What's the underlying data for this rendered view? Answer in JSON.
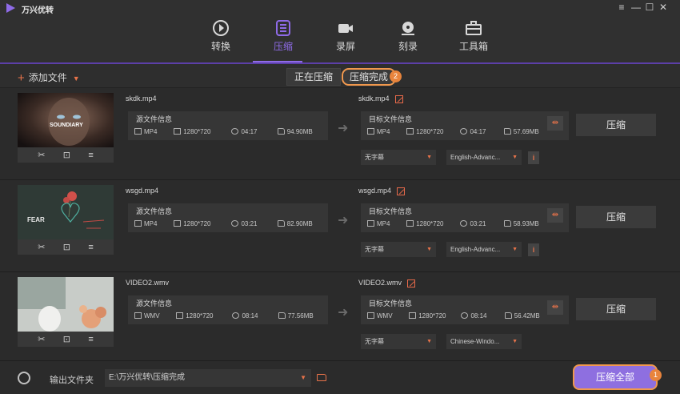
{
  "app": {
    "title": "万兴优转"
  },
  "nav": {
    "items": [
      {
        "label": "转换",
        "icon": "convert-icon"
      },
      {
        "label": "压缩",
        "icon": "compress-icon",
        "active": true
      },
      {
        "label": "录屏",
        "icon": "record-icon"
      },
      {
        "label": "刻录",
        "icon": "burn-icon"
      },
      {
        "label": "工具箱",
        "icon": "toolbox-icon"
      }
    ]
  },
  "toolbar": {
    "add_file": "添加文件",
    "tab_compressing": "正在压缩",
    "tab_done": "压缩完成",
    "tab_done_badge": "2"
  },
  "files": [
    {
      "name": "skdk.mp4",
      "source_label": "源文件信息",
      "src": {
        "format": "MP4",
        "resolution": "1280*720",
        "duration": "04:17",
        "size": "94.90MB"
      },
      "out_name": "skdk.mp4",
      "target_label": "目标文件信息",
      "dst": {
        "format": "MP4",
        "resolution": "1280*720",
        "duration": "04:17",
        "size": "57.69MB"
      },
      "compress": "压缩",
      "subtitle": "无字幕",
      "audio": "English-Advanc...",
      "thumb_text": "SOUNDIARY"
    },
    {
      "name": "wsgd.mp4",
      "source_label": "源文件信息",
      "src": {
        "format": "MP4",
        "resolution": "1280*720",
        "duration": "03:21",
        "size": "82.90MB"
      },
      "out_name": "wsgd.mp4",
      "target_label": "目标文件信息",
      "dst": {
        "format": "MP4",
        "resolution": "1280*720",
        "duration": "03:21",
        "size": "58.93MB"
      },
      "compress": "压缩",
      "subtitle": "无字幕",
      "audio": "English-Advanc...",
      "thumb_text": "FEAR"
    },
    {
      "name": "VIDEO2.wmv",
      "source_label": "源文件信息",
      "src": {
        "format": "WMV",
        "resolution": "1280*720",
        "duration": "08:14",
        "size": "77.56MB"
      },
      "out_name": "VIDEO2.wmv",
      "target_label": "目标文件信息",
      "dst": {
        "format": "WMV",
        "resolution": "1280*720",
        "duration": "08:14",
        "size": "56.42MB"
      },
      "compress": "压缩",
      "subtitle": "无字幕",
      "audio": "Chinese-Windo..."
    }
  ],
  "footer": {
    "output_label": "输出文件夹",
    "output_path": "E:\\万兴优转\\压缩完成",
    "compress_all": "压缩全部",
    "compress_all_badge": "1"
  },
  "colors": {
    "accent": "#8f6be8",
    "orange": "#e8734a",
    "highlight": "#f0984e"
  }
}
